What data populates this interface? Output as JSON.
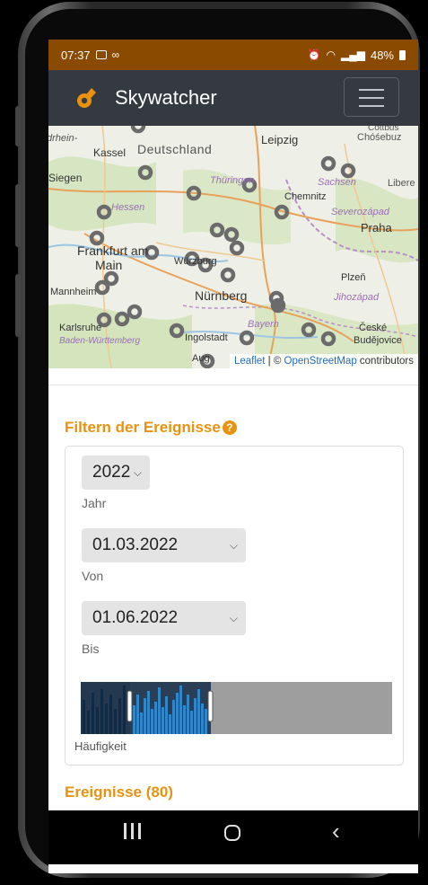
{
  "statusbar": {
    "time": "07:37",
    "battery": "48%"
  },
  "navbar": {
    "brand": "Skywatcher"
  },
  "map": {
    "labels": [
      {
        "text": "drhein-"
      },
      {
        "text": "Kassel"
      },
      {
        "text": "Deutschland"
      },
      {
        "text": "Leipzig"
      },
      {
        "text": "Cottbus"
      },
      {
        "text": "Chóśebuz"
      },
      {
        "text": "Siegen"
      },
      {
        "text": "Thüringen"
      },
      {
        "text": "Sachsen"
      },
      {
        "text": "Libere"
      },
      {
        "text": "Chemnitz"
      },
      {
        "text": "Hessen"
      },
      {
        "text": "Severozápad"
      },
      {
        "text": "Praha"
      },
      {
        "text": "Frankfurt am"
      },
      {
        "text": "Main"
      },
      {
        "text": "Würzburg"
      },
      {
        "text": "Plzeň"
      },
      {
        "text": "Mannheim"
      },
      {
        "text": "Nürnberg"
      },
      {
        "text": "Jihozápad"
      },
      {
        "text": "Karlsruhe"
      },
      {
        "text": "Bayern"
      },
      {
        "text": "České"
      },
      {
        "text": "Baden-Württemberg"
      },
      {
        "text": "Ingolstadt"
      },
      {
        "text": "Budějovice"
      },
      {
        "text": "Aug"
      }
    ],
    "attribution_link1": "Leaflet",
    "attribution_sep": " | © ",
    "attribution_link2": "OpenStreetMap",
    "attribution_suffix": " contributors"
  },
  "filter": {
    "title": "Filtern der Ereignisse",
    "help_icon": "?",
    "year_value": "2022",
    "year_label": "Jahr",
    "from_value": "01.03.2022",
    "from_label": "Von",
    "to_value": "01.06.2022",
    "to_label": "Bis",
    "histogram_label": "Häufigkeit"
  },
  "events": {
    "title": "Ereignisse (80)"
  },
  "icons": {
    "menu": "hamburger-icon",
    "logo": "meteor-icon",
    "help": "question-circle-icon",
    "chevron": "chevron-down-icon",
    "back": "back-icon",
    "home": "home-icon",
    "recent": "recent-apps-icon"
  },
  "colors": {
    "accent": "#e8920f",
    "navbar": "#343a40",
    "statusbar": "#8a4a00",
    "histogram_selected": "#2a7ab5"
  }
}
